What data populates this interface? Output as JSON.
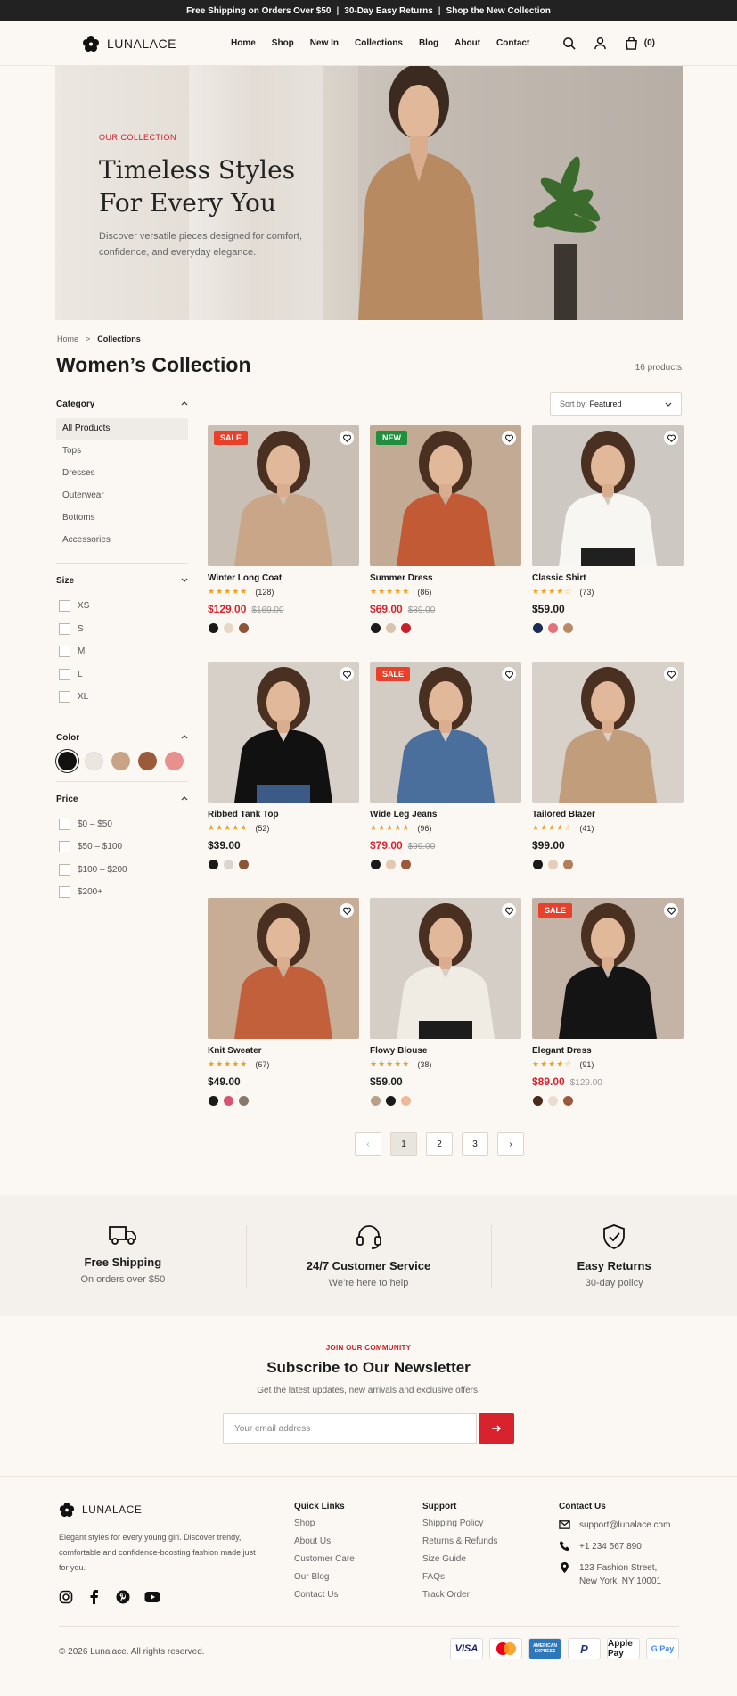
{
  "topbar": {
    "item1": "Free Shipping on Orders Over $50",
    "item2": "30-Day Easy Returns",
    "item3": "Shop the New Collection",
    "sep": "|"
  },
  "brand": {
    "name": "LUNALACE"
  },
  "nav": [
    "Home",
    "Shop",
    "New In",
    "Collections",
    "Blog",
    "About",
    "Contact"
  ],
  "cart": {
    "count": "(0)"
  },
  "hero": {
    "eyebrow": "OUR COLLECTION",
    "title_line1": "Timeless Styles",
    "title_line2": "For Every You",
    "description": "Discover versatile pieces designed for comfort, confidence, and everyday elegance."
  },
  "breadcrumb": {
    "home": "Home",
    "sep": ">",
    "current": "Collections"
  },
  "page": {
    "title": "Women’s Collection",
    "count": "16 products"
  },
  "filters": {
    "category_label": "Category",
    "categories": [
      "All Products",
      "Tops",
      "Dresses",
      "Outerwear",
      "Bottoms",
      "Accessories"
    ],
    "size_label": "Size",
    "sizes": [
      "XS",
      "S",
      "M",
      "L",
      "XL"
    ],
    "color_label": "Color",
    "colors": [
      "#111111",
      "#ece6df",
      "#c8a386",
      "#9b5a3a",
      "#e8908e"
    ],
    "price_label": "Price",
    "prices": [
      "$0 – $50",
      "$50 – $100",
      "$100 – $200",
      "$200+"
    ]
  },
  "sort": {
    "label": "Sort by:",
    "value": "Featured"
  },
  "products": [
    {
      "name": "Winter Long Coat",
      "reviews": "(128)",
      "price": "$129.00",
      "old_price": "$169.00",
      "badge": "SALE",
      "rating": 4.5,
      "colors": [
        "#1a1a1a",
        "#e8d7c7",
        "#8b5638"
      ]
    },
    {
      "name": "Summer Dress",
      "reviews": "(86)",
      "price": "$69.00",
      "old_price": "$89.00",
      "badge": "NEW",
      "rating": 4.5,
      "colors": [
        "#1a1a1a",
        "#d8c3ad",
        "#c8202a"
      ]
    },
    {
      "name": "Classic Shirt",
      "reviews": "(73)",
      "price": "$59.00",
      "old_price": "",
      "badge": "",
      "rating": 4,
      "colors": [
        "#1a2d55",
        "#e2727a",
        "#b88a68"
      ]
    },
    {
      "name": "Ribbed Tank Top",
      "reviews": "(52)",
      "price": "$39.00",
      "old_price": "",
      "badge": "",
      "rating": 4.5,
      "colors": [
        "#1a1a1a",
        "#ddd5cd",
        "#8b5638"
      ]
    },
    {
      "name": "Wide Leg Jeans",
      "reviews": "(96)",
      "price": "$79.00",
      "old_price": "$99.00",
      "badge": "SALE",
      "rating": 4.5,
      "colors": [
        "#1a1a1a",
        "#e4c8b2",
        "#9b5a3a"
      ]
    },
    {
      "name": "Tailored Blazer",
      "reviews": "(41)",
      "price": "$99.00",
      "old_price": "",
      "badge": "",
      "rating": 4,
      "colors": [
        "#1a1a1a",
        "#e6cdb9",
        "#b07f5a"
      ]
    },
    {
      "name": "Knit Sweater",
      "reviews": "(67)",
      "price": "$49.00",
      "old_price": "",
      "badge": "",
      "rating": 4.5,
      "colors": [
        "#1a1a1a",
        "#d95470",
        "#8a7868"
      ]
    },
    {
      "name": "Flowy Blouse",
      "reviews": "(38)",
      "price": "$59.00",
      "old_price": "",
      "badge": "",
      "rating": 4.5,
      "colors": [
        "#b9a08a",
        "#1a1a1a",
        "#f0b89a"
      ]
    },
    {
      "name": "Elegant Dress",
      "reviews": "(91)",
      "price": "$89.00",
      "old_price": "$129.00",
      "badge": "SALE",
      "rating": 4,
      "colors": [
        "#4a2a18",
        "#e8ddd0",
        "#9b5a3a"
      ]
    }
  ],
  "pagination": {
    "prev": "‹",
    "pages": [
      "1",
      "2",
      "3"
    ],
    "next": "›"
  },
  "features": [
    {
      "title": "Free Shipping",
      "sub": "On orders over $50",
      "icon": "truck-icon"
    },
    {
      "title": "24/7 Customer Service",
      "sub": "We’re here to help",
      "icon": "headset-icon"
    },
    {
      "title": "Easy Returns",
      "sub": "30-day policy",
      "icon": "shield-check-icon"
    }
  ],
  "newsletter": {
    "eyebrow": "JOIN OUR COMMUNITY",
    "title": "Subscribe to Our Newsletter",
    "sub": "Get the latest updates, new arrivals and exclusive offers.",
    "placeholder": "Your email address"
  },
  "footer": {
    "about": "Elegant styles for every young girl. Discover trendy, comfortable and confidence-boosting fashion made just for you.",
    "quick_title": "Quick Links",
    "quick": [
      "Shop",
      "About Us",
      "Customer Care",
      "Our Blog",
      "Contact Us"
    ],
    "support_title": "Support",
    "support": [
      "Shipping Policy",
      "Returns & Refunds",
      "Size Guide",
      "FAQs",
      "Track Order"
    ],
    "contact_title": "Contact Us",
    "email": "support@lunalace.com",
    "phone": "+1 234 567 890",
    "address_line1": "123 Fashion Street,",
    "address_line2": "New York, NY 10001",
    "copyright": "© 2026 Lunalace. All rights reserved.",
    "payments": [
      "VISA",
      "Mastercard",
      "AMERICAN EXPRESS",
      "PayPal",
      "Apple Pay",
      "G Pay"
    ]
  },
  "colors": {
    "accent": "#d8232f",
    "sale_badge": "#e8402a",
    "new_badge": "#1e8f3c",
    "star": "#f0a020",
    "topbar": "#222222"
  }
}
